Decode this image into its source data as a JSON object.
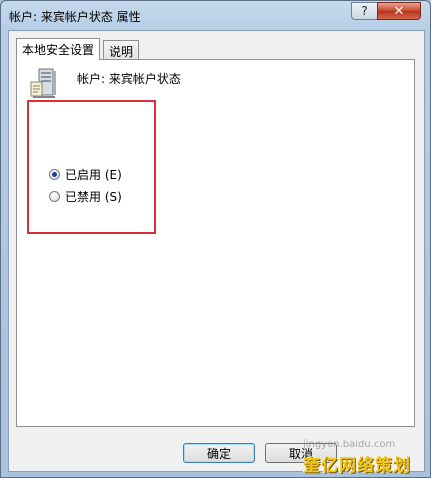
{
  "window": {
    "title": "帐户: 来宾帐户状态 属性",
    "help_glyph": "?",
    "close_glyph": "✕"
  },
  "tabs": [
    {
      "label": "本地安全设置",
      "active": true
    },
    {
      "label": "说明",
      "active": false
    }
  ],
  "policy": {
    "name": "帐户: 来宾帐户状态",
    "icon": "server-policy-icon"
  },
  "options": [
    {
      "label": "已启用 (E)",
      "checked": true
    },
    {
      "label": "已禁用 (S)",
      "checked": false
    }
  ],
  "buttons": {
    "ok": "确定",
    "cancel": "取消"
  },
  "watermark": {
    "top_text": "jingyan.baidu.com",
    "main_text": "奎亿网络策划"
  },
  "colors": {
    "highlight_box": "#d8303a",
    "radio_dot": "#1e3f8f",
    "close_button": "#c7442c"
  }
}
